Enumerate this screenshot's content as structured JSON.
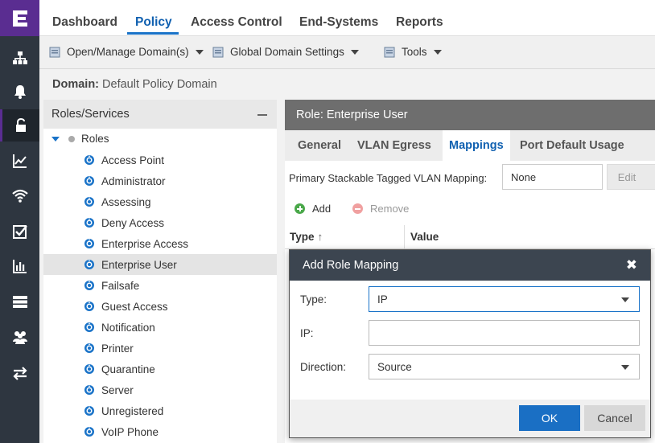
{
  "top_tabs": [
    "Dashboard",
    "Policy",
    "Access Control",
    "End-Systems",
    "Reports"
  ],
  "toolbar": {
    "open_manage": "Open/Manage Domain(s)",
    "global_settings": "Global Domain Settings",
    "tools": "Tools"
  },
  "domain": {
    "label": "Domain:",
    "value": "Default Policy Domain"
  },
  "tree": {
    "title": "Roles/Services",
    "root": "Roles",
    "items": [
      "Access Point",
      "Administrator",
      "Assessing",
      "Deny Access",
      "Enterprise Access",
      "Enterprise User",
      "Failsafe",
      "Guest Access",
      "Notification",
      "Printer",
      "Quarantine",
      "Server",
      "Unregistered",
      "VoIP Phone"
    ],
    "selected": "Enterprise User"
  },
  "role_panel": {
    "title": "Role: Enterprise User",
    "tabs": [
      "General",
      "VLAN Egress",
      "Mappings",
      "Port Default Usage"
    ],
    "active_tab": "Mappings",
    "vlan_label": "Primary Stackable Tagged VLAN Mapping:",
    "vlan_value": "None",
    "edit_label": "Edit",
    "add_label": "Add",
    "remove_label": "Remove",
    "col_type": "Type",
    "col_sort": "↑",
    "col_value": "Value"
  },
  "modal": {
    "title": "Add Role Mapping",
    "close": "✖",
    "type_label": "Type:",
    "type_value": "IP",
    "ip_label": "IP:",
    "ip_value": "",
    "direction_label": "Direction:",
    "direction_value": "Source",
    "ok": "OK",
    "cancel": "Cancel"
  },
  "colors": {
    "brand": "#5a2d91",
    "sidebar": "#2e3640",
    "accent": "#1a73c8",
    "modal_header": "#3c4550",
    "role_header": "#6e6e6e"
  },
  "nav_icons": [
    "hierarchy-icon",
    "bell-icon",
    "lock-icon",
    "chart-line-icon",
    "wifi-icon",
    "checkbox-icon",
    "bar-chart-icon",
    "server-icon",
    "users-icon",
    "transfer-icon"
  ]
}
